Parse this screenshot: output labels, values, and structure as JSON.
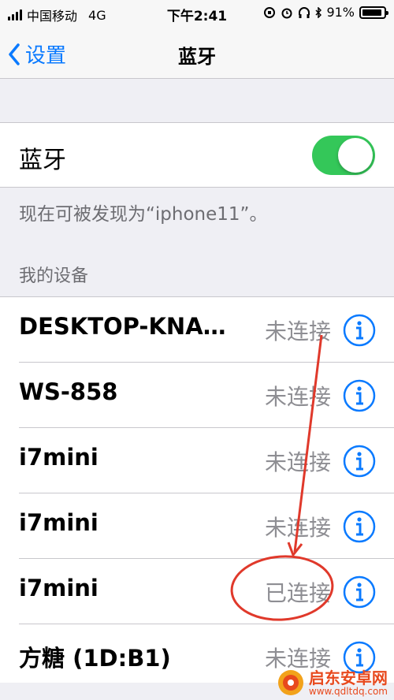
{
  "status_bar": {
    "carrier": "中国移动",
    "network": "4G",
    "time": "下午2:41",
    "battery_percent": "91%",
    "battery_level": 0.91
  },
  "nav": {
    "back_label": "设置",
    "title": "蓝牙"
  },
  "bluetooth": {
    "label": "蓝牙",
    "enabled": true,
    "accent_color": "#34c759"
  },
  "discoverable_text": "现在可被发现为“iphone11”。",
  "my_devices": {
    "header": "我的设备",
    "items": [
      {
        "name": "DESKTOP-KNA…",
        "status": "未连接"
      },
      {
        "name": "WS-858",
        "status": "未连接"
      },
      {
        "name": "i7mini",
        "status": "未连接"
      },
      {
        "name": "i7mini",
        "status": "未连接"
      },
      {
        "name": "i7mini",
        "status": "已连接"
      },
      {
        "name": "方糖 (1D:B1)",
        "status": "未连接"
      }
    ]
  },
  "watermark": {
    "title": "启东安卓网",
    "url": "www.qdltdq.com"
  },
  "colors": {
    "link": "#0a7aff",
    "annotation": "#e0392b"
  }
}
